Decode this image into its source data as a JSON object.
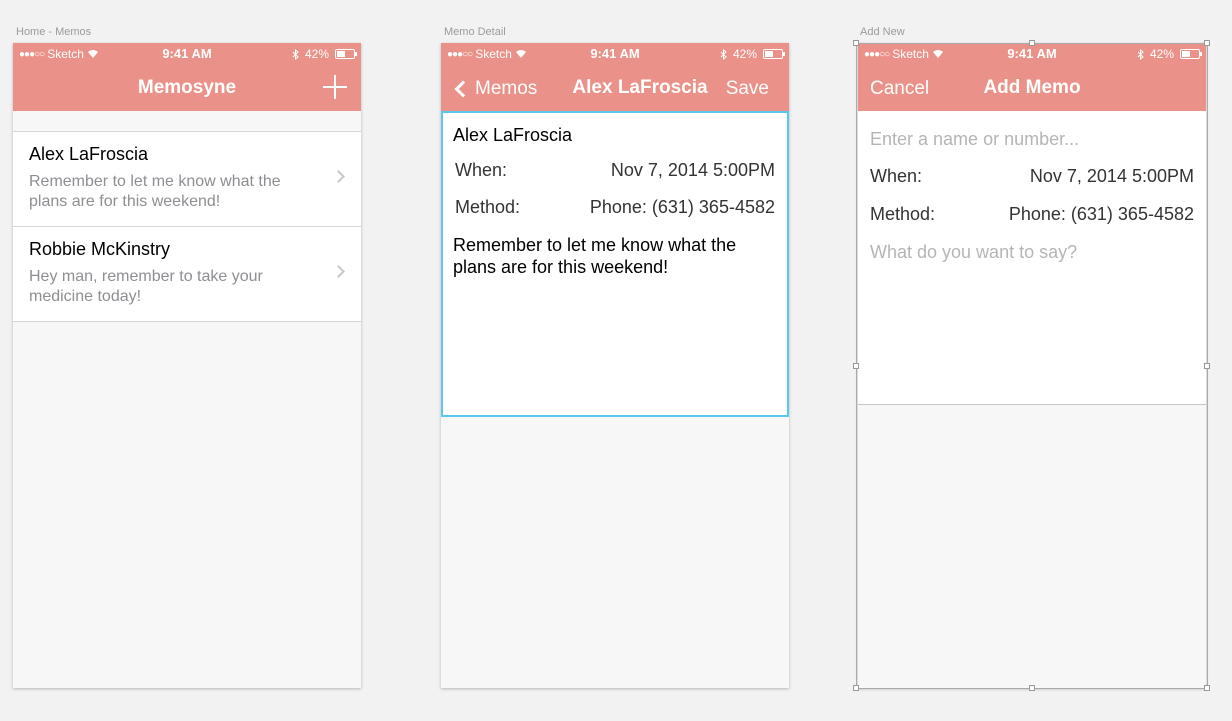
{
  "artboards": {
    "home": "Home - Memos",
    "detail": "Memo Detail",
    "add": "Add New"
  },
  "status": {
    "carrier": "Sketch",
    "time": "9:41 AM",
    "battery": "42%",
    "battery_level": 0.42
  },
  "home": {
    "title": "Memosyne",
    "items": [
      {
        "name": "Alex LaFroscia",
        "preview": "Remember to let me know what the plans are for this weekend!"
      },
      {
        "name": "Robbie McKinstry",
        "preview": "Hey man, remember to take your medicine today!"
      }
    ]
  },
  "detail": {
    "back": "Memos",
    "title": "Alex LaFroscia",
    "save": "Save",
    "name": "Alex LaFroscia",
    "when_label": "When:",
    "when_value": "Nov 7, 2014 5:00PM",
    "method_label": "Method:",
    "method_value": "Phone: (631) 365-4582",
    "message": "Remember to let me know what the plans are for this weekend!"
  },
  "add": {
    "cancel": "Cancel",
    "title": "Add Memo",
    "name_placeholder": "Enter a name or number...",
    "when_label": "When:",
    "when_value": "Nov 7, 2014 5:00PM",
    "method_label": "Method:",
    "method_value": "Phone: (631) 365-4582",
    "message_placeholder": "What do you want to say?"
  },
  "colors": {
    "accent": "#ea9189",
    "selection": "#5ac8ea"
  },
  "icons": [
    "signal-dots-icon",
    "wifi-icon",
    "bluetooth-icon",
    "battery-icon",
    "plus-icon",
    "chevron-right-icon",
    "back-chevron-icon"
  ]
}
